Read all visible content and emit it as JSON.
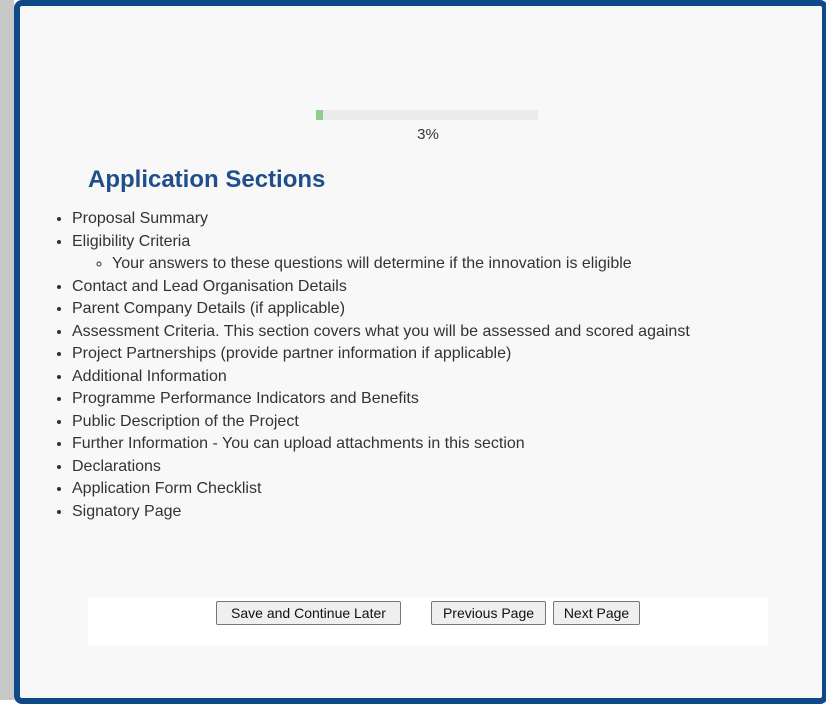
{
  "progress": {
    "value": 0.03,
    "label": "3%"
  },
  "heading": "Application Sections",
  "sections": [
    {
      "label": "Proposal Summary"
    },
    {
      "label": "Eligibility Criteria",
      "sub": [
        "Your answers to these questions will determine if the innovation is eligible"
      ]
    },
    {
      "label": "Contact and Lead Organisation Details"
    },
    {
      "label": "Parent Company Details (if applicable)"
    },
    {
      "label": "Assessment Criteria. This section covers what you will be assessed and scored against"
    },
    {
      "label": "Project Partnerships (provide partner information if applicable)"
    },
    {
      "label": "Additional Information"
    },
    {
      "label": "Programme Performance Indicators and Benefits"
    },
    {
      "label": "Public Description of the Project"
    },
    {
      "label": "Further Information - You can upload attachments in this section"
    },
    {
      "label": "Declarations"
    },
    {
      "label": "Application Form Checklist"
    },
    {
      "label": "Signatory Page"
    }
  ],
  "buttons": {
    "save_label": "Save and Continue Later",
    "prev_label": "Previous Page",
    "next_label": "Next Page"
  },
  "colors": {
    "frame_border": "#0e4a8a",
    "heading": "#1f4e8a",
    "progress_fill": "#8ccf8c",
    "progress_track": "#ebebeb"
  }
}
